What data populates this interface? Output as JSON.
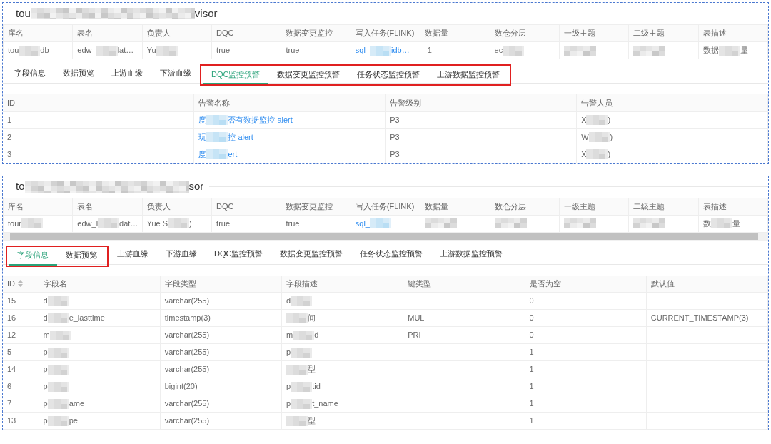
{
  "panels": [
    {
      "title": {
        "before": "tou",
        "after": "visor"
      },
      "info_table": {
        "columns": [
          "库名",
          "表名",
          "负责人",
          "DQC",
          "数据变更监控",
          "写入任务(FLINK)",
          "数据量",
          "数仓分层",
          "一级主题",
          "二级主题",
          "表描述"
        ],
        "rows": [
          [
            {
              "before": "tou",
              "after": "db"
            },
            {
              "before": "edw_",
              "after": "lat…"
            },
            {
              "before": "Yu"
            },
            "true",
            "true",
            {
              "before": "sql_",
              "after": "idb…",
              "link": true
            },
            "-1",
            {
              "before": "ec"
            },
            {},
            {},
            {
              "before": "数据",
              "after": "量"
            }
          ]
        ]
      },
      "scrollbar": false,
      "tabs": [
        {
          "label": "字段信息",
          "selected": false,
          "highlighted": false
        },
        {
          "label": "数据预览",
          "selected": false,
          "highlighted": false
        },
        {
          "label": "上游血缘",
          "selected": false,
          "highlighted": false
        },
        {
          "label": "下游血缘",
          "selected": false,
          "highlighted": false
        },
        {
          "label": "DQC监控预警",
          "selected": true,
          "highlighted": true
        },
        {
          "label": "数据变更监控预警",
          "selected": false,
          "highlighted": true
        },
        {
          "label": "任务状态监控预警",
          "selected": false,
          "highlighted": true
        },
        {
          "label": "上游数据监控预警",
          "selected": false,
          "highlighted": true
        }
      ],
      "table": {
        "columns": [
          {
            "label": "ID",
            "sortable": false
          },
          {
            "label": "告警名称",
            "sortable": false
          },
          {
            "label": "告警级别",
            "sortable": false
          },
          {
            "label": "告警人员",
            "sortable": false
          }
        ],
        "rows": [
          [
            "1",
            {
              "before": "度",
              "after": "否有数据监控 alert",
              "link": true
            },
            "P3",
            {
              "before": "X",
              "after": ")"
            }
          ],
          [
            "2",
            {
              "before": "玩",
              "after": "控 alert",
              "link": true
            },
            "P3",
            {
              "before": "W",
              "after": ")"
            }
          ],
          [
            "3",
            {
              "before": "度",
              "after": "ert",
              "link": true
            },
            "P3",
            {
              "before": "X",
              "after": ")"
            }
          ]
        ]
      }
    },
    {
      "title": {
        "before": "to",
        "after": "sor"
      },
      "info_table": {
        "columns": [
          "库名",
          "表名",
          "负责人",
          "DQC",
          "数据变更监控",
          "写入任务(FLINK)",
          "数据量",
          "数仓分层",
          "一级主题",
          "二级主题",
          "表描述"
        ],
        "rows": [
          [
            {
              "before": "tour"
            },
            {
              "before": "edw_l",
              "after": "dat…"
            },
            {
              "before": "Yue S",
              "after": ")"
            },
            "true",
            "true",
            {
              "before": "sql_",
              "link": true
            },
            {},
            {},
            {},
            {},
            {
              "before": "数",
              "after": "量"
            }
          ]
        ]
      },
      "scrollbar": true,
      "tabs": [
        {
          "label": "字段信息",
          "selected": true,
          "highlighted": true
        },
        {
          "label": "数据预览",
          "selected": false,
          "highlighted": true
        },
        {
          "label": "上游血缘",
          "selected": false,
          "highlighted": false
        },
        {
          "label": "下游血缘",
          "selected": false,
          "highlighted": false
        },
        {
          "label": "DQC监控预警",
          "selected": false,
          "highlighted": false
        },
        {
          "label": "数据变更监控预警",
          "selected": false,
          "highlighted": false
        },
        {
          "label": "任务状态监控预警",
          "selected": false,
          "highlighted": false
        },
        {
          "label": "上游数据监控预警",
          "selected": false,
          "highlighted": false
        }
      ],
      "table": {
        "columns": [
          {
            "label": "ID",
            "sortable": true
          },
          {
            "label": "字段名",
            "sortable": false
          },
          {
            "label": "字段类型",
            "sortable": false
          },
          {
            "label": "字段描述",
            "sortable": false
          },
          {
            "label": "键类型",
            "sortable": false
          },
          {
            "label": "是否为空",
            "sortable": false
          },
          {
            "label": "默认值",
            "sortable": false
          }
        ],
        "rows": [
          [
            "15",
            {
              "before": "d"
            },
            "varchar(255)",
            {
              "before": "d"
            },
            null,
            "0",
            null
          ],
          [
            "16",
            {
              "before": "d",
              "after": "e_lasttime"
            },
            "timestamp(3)",
            {
              "after": "间"
            },
            "MUL",
            "0",
            "CURRENT_TIMESTAMP(3)"
          ],
          [
            "12",
            {
              "before": "m"
            },
            "varchar(255)",
            {
              "before": "m",
              "after": "d"
            },
            "PRI",
            "0",
            null
          ],
          [
            "5",
            {
              "before": "p"
            },
            "varchar(255)",
            {
              "before": "p"
            },
            null,
            "1",
            null
          ],
          [
            "14",
            {
              "before": "p"
            },
            "varchar(255)",
            {
              "after": "型"
            },
            null,
            "1",
            null
          ],
          [
            "6",
            {
              "before": "p"
            },
            "bigint(20)",
            {
              "before": "p",
              "after": "tid"
            },
            null,
            "1",
            null
          ],
          [
            "7",
            {
              "before": "p",
              "after": "ame"
            },
            "varchar(255)",
            {
              "before": "p",
              "after": "t_name"
            },
            null,
            "1",
            null
          ],
          [
            "13",
            {
              "before": "p",
              "after": "pe"
            },
            "varchar(255)",
            {
              "after": "型"
            },
            null,
            "1",
            null
          ]
        ]
      }
    }
  ]
}
